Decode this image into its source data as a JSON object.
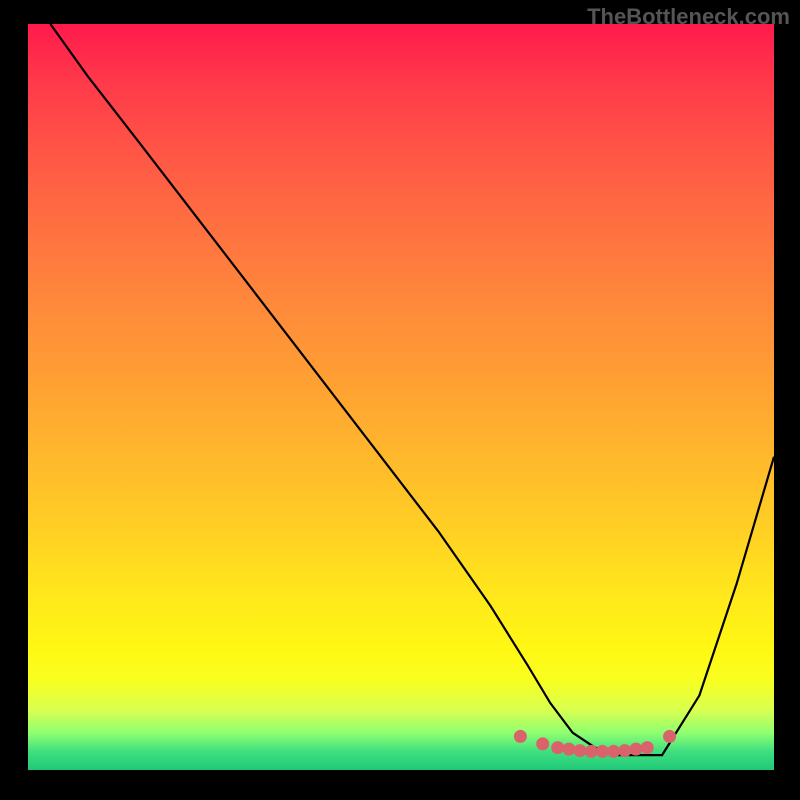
{
  "watermark": "TheBottleneck.com",
  "chart_data": {
    "type": "line",
    "title": "",
    "xlabel": "",
    "ylabel": "",
    "xlim": [
      0,
      100
    ],
    "ylim": [
      0,
      100
    ],
    "series": [
      {
        "name": "curve",
        "x": [
          3,
          8,
          15,
          25,
          35,
          45,
          55,
          62,
          67,
          70,
          73,
          76,
          79,
          82,
          85,
          90,
          95,
          100
        ],
        "y": [
          100,
          93,
          84,
          71,
          58,
          45,
          32,
          22,
          14,
          9,
          5,
          3,
          2,
          2,
          2,
          10,
          25,
          42
        ]
      }
    ],
    "markers": {
      "name": "optimal-zone",
      "color": "#d9626b",
      "points": [
        {
          "x": 66,
          "y": 4.5
        },
        {
          "x": 69,
          "y": 3.5
        },
        {
          "x": 71,
          "y": 3
        },
        {
          "x": 72.5,
          "y": 2.8
        },
        {
          "x": 74,
          "y": 2.6
        },
        {
          "x": 75.5,
          "y": 2.5
        },
        {
          "x": 77,
          "y": 2.5
        },
        {
          "x": 78.5,
          "y": 2.5
        },
        {
          "x": 80,
          "y": 2.6
        },
        {
          "x": 81.5,
          "y": 2.8
        },
        {
          "x": 83,
          "y": 3
        },
        {
          "x": 86,
          "y": 4.5
        }
      ]
    },
    "background_gradient": {
      "top": "#ff1a4d",
      "mid": "#ffd024",
      "bottom": "#20c878"
    }
  }
}
